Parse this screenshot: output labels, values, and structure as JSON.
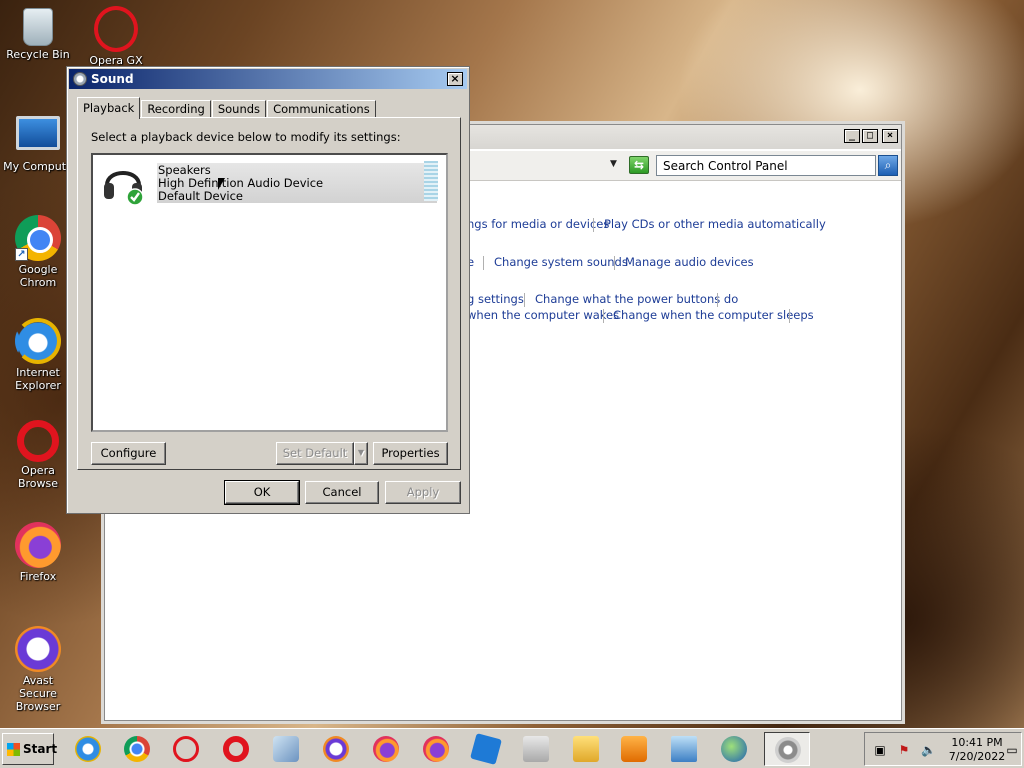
{
  "desktop": {
    "icons": [
      {
        "label": "Recycle Bin",
        "icon": "recycle-bin-icon"
      },
      {
        "label": "Opera GX",
        "icon": "opera-gx-icon"
      },
      {
        "label": "My Compute",
        "icon": "my-computer-icon"
      },
      {
        "label": "Google Chrom",
        "icon": "chrome-icon"
      },
      {
        "label": "Internet Explorer",
        "icon": "internet-explorer-icon"
      },
      {
        "label": "Opera Browse",
        "icon": "opera-icon"
      },
      {
        "label": "Firefox",
        "icon": "firefox-icon"
      },
      {
        "label": "Avast Secure Browser",
        "icon": "avast-icon"
      }
    ]
  },
  "control_panel": {
    "search_placeholder": "Search Control Panel",
    "links": [
      "ngs for media or devices",
      "Play CDs or other media automatically",
      "e",
      "Change system sounds",
      "Manage audio devices",
      "g settings",
      "Change what the power buttons do",
      "when the computer wakes",
      "Change when the computer sleeps"
    ]
  },
  "sound_dialog": {
    "title": "Sound",
    "tabs": [
      "Playback",
      "Recording",
      "Sounds",
      "Communications"
    ],
    "active_tab": "Playback",
    "hint": "Select a playback device below to modify its settings:",
    "device": {
      "name": "Speakers",
      "driver": "High Definition Audio Device",
      "status": "Default Device"
    },
    "buttons": {
      "configure": "Configure",
      "set_default": "Set Default",
      "properties": "Properties",
      "ok": "OK",
      "cancel": "Cancel",
      "apply": "Apply"
    }
  },
  "taskbar": {
    "start_label": "Start",
    "clock_time": "10:41 PM",
    "clock_date": "7/20/2022"
  }
}
